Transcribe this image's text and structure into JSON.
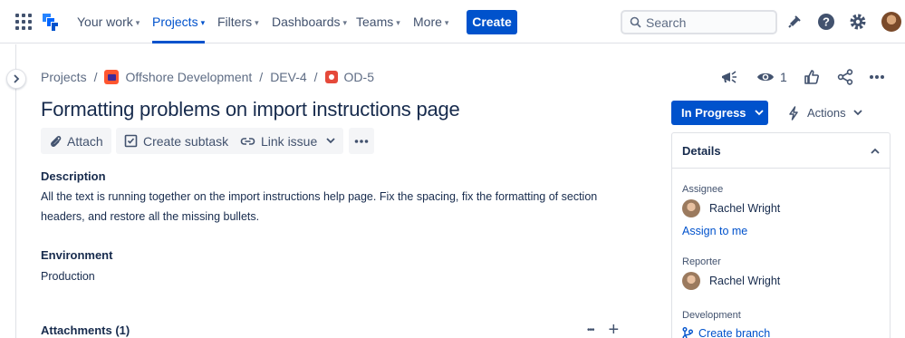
{
  "nav": {
    "items": [
      {
        "label": "Your work",
        "chevron": "▾"
      },
      {
        "label": "Projects",
        "chevron": "▾"
      },
      {
        "label": "Filters",
        "chevron": "▾"
      },
      {
        "label": "Dashboards",
        "chevron": "▾"
      },
      {
        "label": "Teams",
        "chevron": "▾"
      },
      {
        "label": "More",
        "chevron": "▾"
      }
    ],
    "active": "Projects",
    "create_label": "Create",
    "search_placeholder": "Search"
  },
  "breadcrumb": {
    "items": [
      "Projects",
      "Offshore Development",
      "DEV-4",
      "OD-5"
    ],
    "separator": "/"
  },
  "issue": {
    "title": "Formatting problems on import instructions page",
    "watch_count": "1",
    "toolbar": {
      "attach": "Attach",
      "create_subtask": "Create subtask",
      "link_issue": "Link issue"
    },
    "description_label": "Description",
    "description_text": "All the text is running together on the import instructions help page. Fix the spacing, fix the formatting of section headers, and restore all the missing bullets.",
    "environment_label": "Environment",
    "environment_text": "Production",
    "attachments_label": "Attachments (1)",
    "attachments_add": "+",
    "attachments_more": "•••"
  },
  "sidebar": {
    "status": "In Progress",
    "actions_label": "Actions",
    "details_title": "Details",
    "assignee_label": "Assignee",
    "assignee_name": "Rachel Wright",
    "assign_to_me": "Assign to me",
    "reporter_label": "Reporter",
    "reporter_name": "Rachel Wright",
    "development_label": "Development",
    "create_branch": "Create branch"
  },
  "colors": {
    "brand": "#0052cc",
    "text": "#172b4d",
    "muted": "#42526e",
    "border": "#dfe1e6",
    "button_bg": "#f4f5f7"
  }
}
